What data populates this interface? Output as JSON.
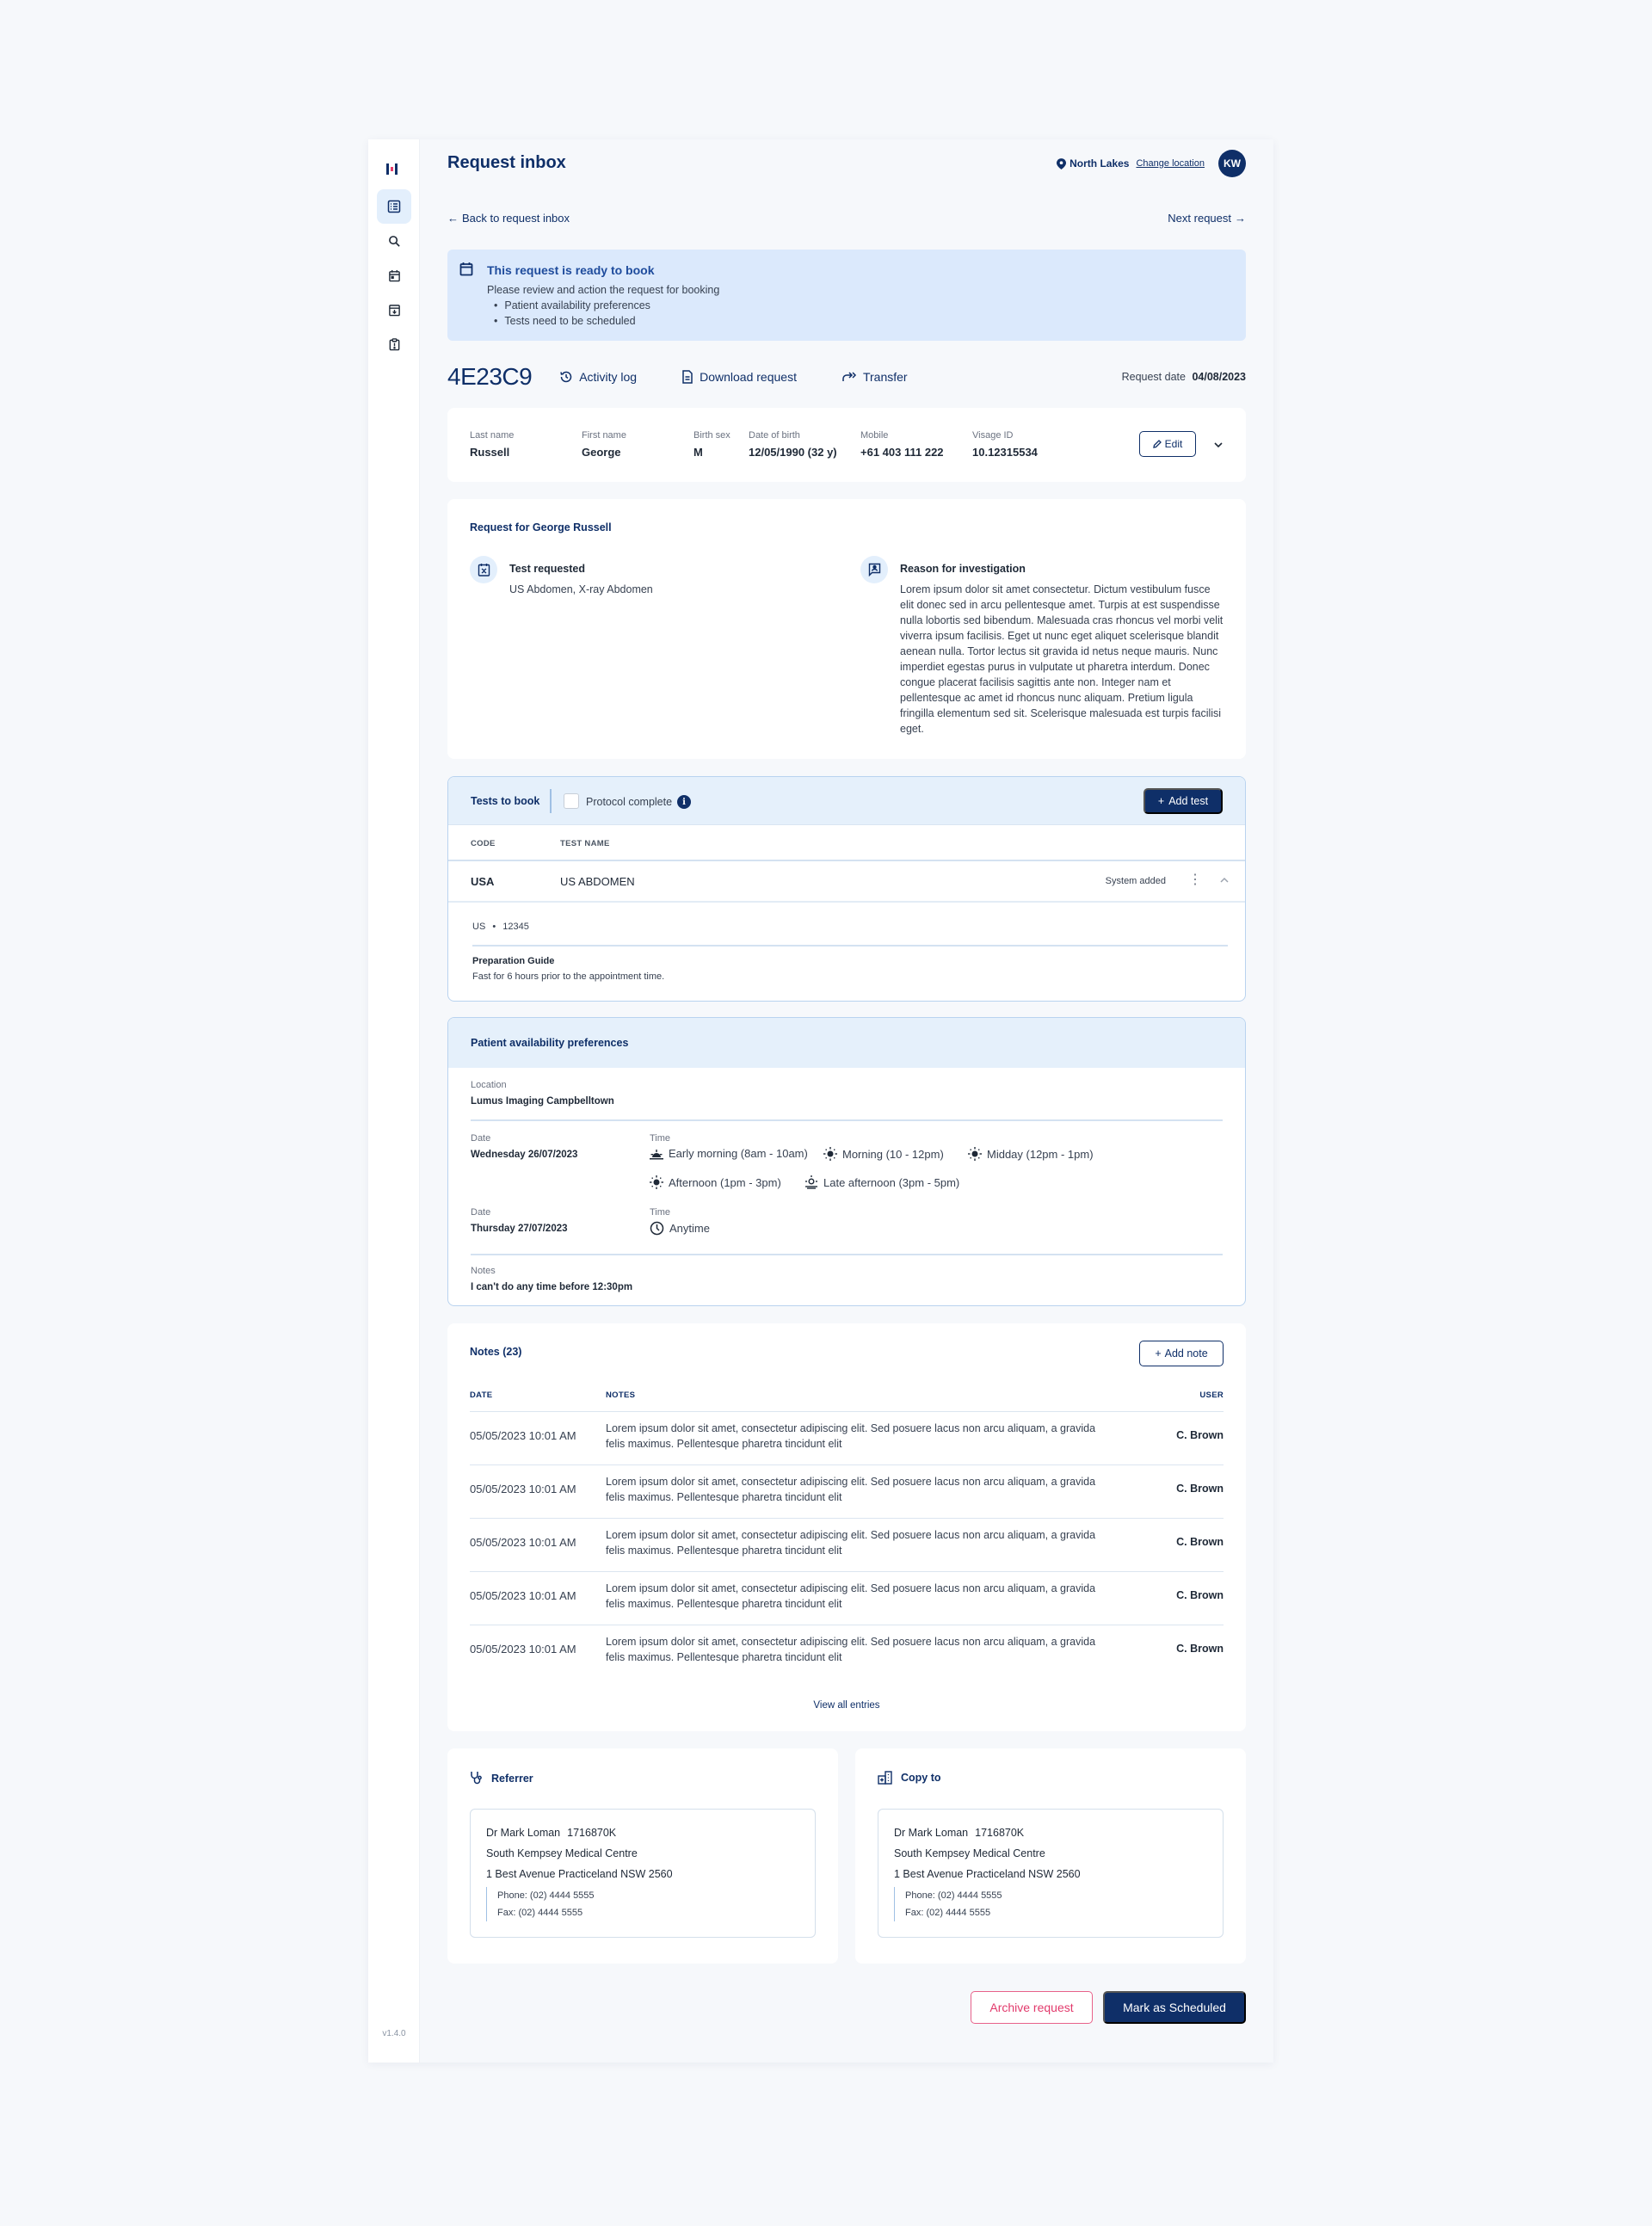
{
  "app": {
    "version": "v1.4.0"
  },
  "sidebar": {
    "items": [
      {
        "name": "request-inbox",
        "icon": "list-icon",
        "active": true
      },
      {
        "name": "search",
        "icon": "search-icon",
        "active": false
      },
      {
        "name": "calendar",
        "icon": "calendar-icon",
        "active": false
      },
      {
        "name": "archive",
        "icon": "archive-icon",
        "active": false
      },
      {
        "name": "alerts",
        "icon": "clipboard-alert-icon",
        "active": false
      }
    ]
  },
  "header": {
    "title": "Request inbox",
    "location": "North Lakes",
    "change_location": "Change location",
    "user_initials": "KW"
  },
  "nav": {
    "back": "Back to request inbox",
    "next": "Next request"
  },
  "alert": {
    "title": "This request is ready to book",
    "body": "Please review and action the request for booking",
    "items": [
      "Patient availability preferences",
      "Tests need to be scheduled"
    ]
  },
  "request": {
    "id": "4E23C9",
    "actions": [
      "Activity log",
      "Download request",
      "Transfer"
    ],
    "date_label": "Request date",
    "date": "04/08/2023"
  },
  "patient": {
    "fields": [
      {
        "label": "Last name",
        "value": "Russell"
      },
      {
        "label": "First name",
        "value": "George"
      },
      {
        "label": "Birth sex",
        "value": "M"
      },
      {
        "label": "Date of birth",
        "value": "12/05/1990 (32 y)"
      },
      {
        "label": "Mobile",
        "value": "+61 403 111 222"
      },
      {
        "label": "Visage ID",
        "value": "10.12315534"
      }
    ],
    "edit_label": "Edit"
  },
  "request_details": {
    "title": "Request for George Russell",
    "test_requested_label": "Test requested",
    "test_requested": "US Abdomen, X-ray Abdomen",
    "reason_label": "Reason for investigation",
    "reason": "Lorem ipsum dolor sit amet consectetur. Dictum vestibulum fusce elit donec sed in arcu pellentesque amet. Turpis at est suspendisse nulla lobortis sed bibendum. Malesuada cras rhoncus vel morbi velit viverra ipsum facilisis. Eget ut nunc eget aliquet scelerisque blandit aenean nulla. Tortor lectus sit gravida id netus neque mauris. Nunc imperdiet egestas purus in vulputate ut pharetra interdum. Donec congue placerat facilisis sagittis ante non. Integer nam et pellentesque ac amet id rhoncus nunc aliquam. Pretium ligula fringilla elementum sed sit. Scelerisque malesuada est turpis facilisi eget."
  },
  "tests": {
    "title": "Tests to book",
    "protocol_label": "Protocol complete",
    "protocol_checked": false,
    "add_label": "Add test",
    "columns": [
      "CODE",
      "TEST NAME"
    ],
    "rows": [
      {
        "code": "USA",
        "name": "US ABDOMEN",
        "status": "System added",
        "modality": "US",
        "modality_code": "12345",
        "prep_title": "Preparation Guide",
        "prep_text": "Fast for 6 hours prior to the appointment time."
      }
    ]
  },
  "availability": {
    "title": "Patient availability preferences",
    "location_label": "Location",
    "location": "Lumus Imaging Campbelltown",
    "date_label": "Date",
    "time_label": "Time",
    "days": [
      {
        "date": "Wednesday 26/07/2023",
        "slots": [
          {
            "icon": "sunrise-icon",
            "label": "Early morning (8am - 10am)"
          },
          {
            "icon": "sun-icon",
            "label": "Morning (10 - 12pm)"
          },
          {
            "icon": "sun-icon",
            "label": "Midday (12pm - 1pm)"
          },
          {
            "icon": "sun-icon",
            "label": "Afternoon (1pm - 3pm)"
          },
          {
            "icon": "sunset-icon",
            "label": "Late afternoon (3pm - 5pm)"
          }
        ]
      },
      {
        "date": "Thursday 27/07/2023",
        "slots": [
          {
            "icon": "clock-icon",
            "label": "Anytime"
          }
        ]
      }
    ],
    "notes_label": "Notes",
    "notes": "I can't do any time before 12:30pm"
  },
  "notes": {
    "title": "Notes (23)",
    "add_label": "Add note",
    "columns": [
      "DATE",
      "NOTES",
      "USER"
    ],
    "rows": [
      {
        "date": "05/05/2023 10:01 AM",
        "text": "Lorem ipsum dolor sit amet, consectetur adipiscing elit. Sed posuere lacus non arcu aliquam, a gravida felis maximus. Pellentesque pharetra tincidunt elit",
        "user": "C. Brown"
      },
      {
        "date": "05/05/2023 10:01 AM",
        "text": "Lorem ipsum dolor sit amet, consectetur adipiscing elit. Sed posuere lacus non arcu aliquam, a gravida felis maximus. Pellentesque pharetra tincidunt elit",
        "user": "C. Brown"
      },
      {
        "date": "05/05/2023 10:01 AM",
        "text": "Lorem ipsum dolor sit amet, consectetur adipiscing elit. Sed posuere lacus non arcu aliquam, a gravida felis maximus. Pellentesque pharetra tincidunt elit",
        "user": "C. Brown"
      },
      {
        "date": "05/05/2023 10:01 AM",
        "text": "Lorem ipsum dolor sit amet, consectetur adipiscing elit. Sed posuere lacus non arcu aliquam, a gravida felis maximus. Pellentesque pharetra tincidunt elit",
        "user": "C. Brown"
      },
      {
        "date": "05/05/2023 10:01 AM",
        "text": "Lorem ipsum dolor sit amet, consectetur adipiscing elit. Sed posuere lacus non arcu aliquam, a gravida felis maximus. Pellentesque pharetra tincidunt elit",
        "user": "C. Brown"
      }
    ],
    "view_all": "View all entries"
  },
  "referrer": {
    "title": "Referrer",
    "name": "Dr Mark Loman",
    "provider": "1716870K",
    "practice": "South Kempsey Medical Centre",
    "address": "1 Best Avenue Practiceland NSW 2560",
    "phone": "Phone: (02) 4444 5555",
    "fax": "Fax: (02) 4444 5555"
  },
  "copy_to": {
    "title": "Copy to",
    "name": "Dr Mark Loman",
    "provider": "1716870K",
    "practice": "South Kempsey Medical Centre",
    "address": "1 Best Avenue Practiceland NSW 2560",
    "phone": "Phone: (02) 4444 5555",
    "fax": "Fax: (02) 4444 5555"
  },
  "footer_actions": {
    "archive": "Archive request",
    "schedule": "Mark as Scheduled"
  },
  "colors": {
    "primary": "#0f2f68",
    "alert_bg": "#dbe9fc",
    "danger": "#e23a6c"
  }
}
